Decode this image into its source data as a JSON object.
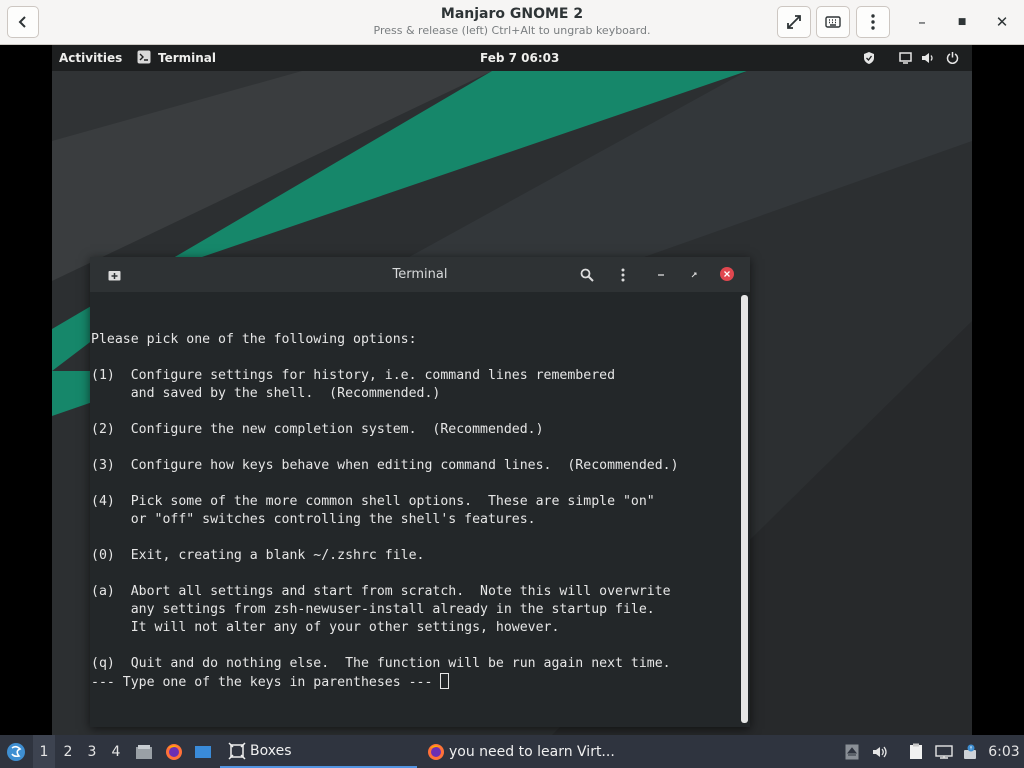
{
  "boxes_header": {
    "title": "Manjaro GNOME 2",
    "subtitle": "Press & release (left) Ctrl+Alt to ungrab keyboard.",
    "back_icon": "chevron-left",
    "fullscreen_icon": "expand-arrows",
    "keyboard_icon": "keyboard",
    "menu_icon": "vertical-dots",
    "minimize_glyph": "–",
    "maximize_glyph": "■",
    "close_glyph": "✕"
  },
  "gnome_topbar": {
    "activities_label": "Activities",
    "app_label": "Terminal",
    "clock": "Feb 7  06:03"
  },
  "terminal": {
    "title": "Terminal",
    "lines": [
      "Please pick one of the following options:",
      "",
      "(1)  Configure settings for history, i.e. command lines remembered",
      "     and saved by the shell.  (Recommended.)",
      "",
      "(2)  Configure the new completion system.  (Recommended.)",
      "",
      "(3)  Configure how keys behave when editing command lines.  (Recommended.)",
      "",
      "(4)  Pick some of the more common shell options.  These are simple \"on\"",
      "     or \"off\" switches controlling the shell's features.",
      "",
      "(0)  Exit, creating a blank ~/.zshrc file.",
      "",
      "(a)  Abort all settings and start from scratch.  Note this will overwrite",
      "     any settings from zsh-newuser-install already in the startup file.",
      "     It will not alter any of your other settings, however.",
      "",
      "(q)  Quit and do nothing else.  The function will be run again next time."
    ],
    "prompt": "--- Type one of the keys in parentheses --- "
  },
  "taskbar": {
    "workspaces": [
      "1",
      "2",
      "3",
      "4"
    ],
    "active_workspace": "1",
    "tasks": [
      {
        "label": "Boxes",
        "icon": "boxes-icon"
      },
      {
        "label": "you need to learn Virt...",
        "icon": "firefox-icon"
      }
    ],
    "clock": "6:03"
  },
  "colors": {
    "accent_green": "#16876a",
    "close_red": "#e0474f",
    "taskbar_bg": "#2f343f",
    "terminal_bg": "#232729"
  }
}
